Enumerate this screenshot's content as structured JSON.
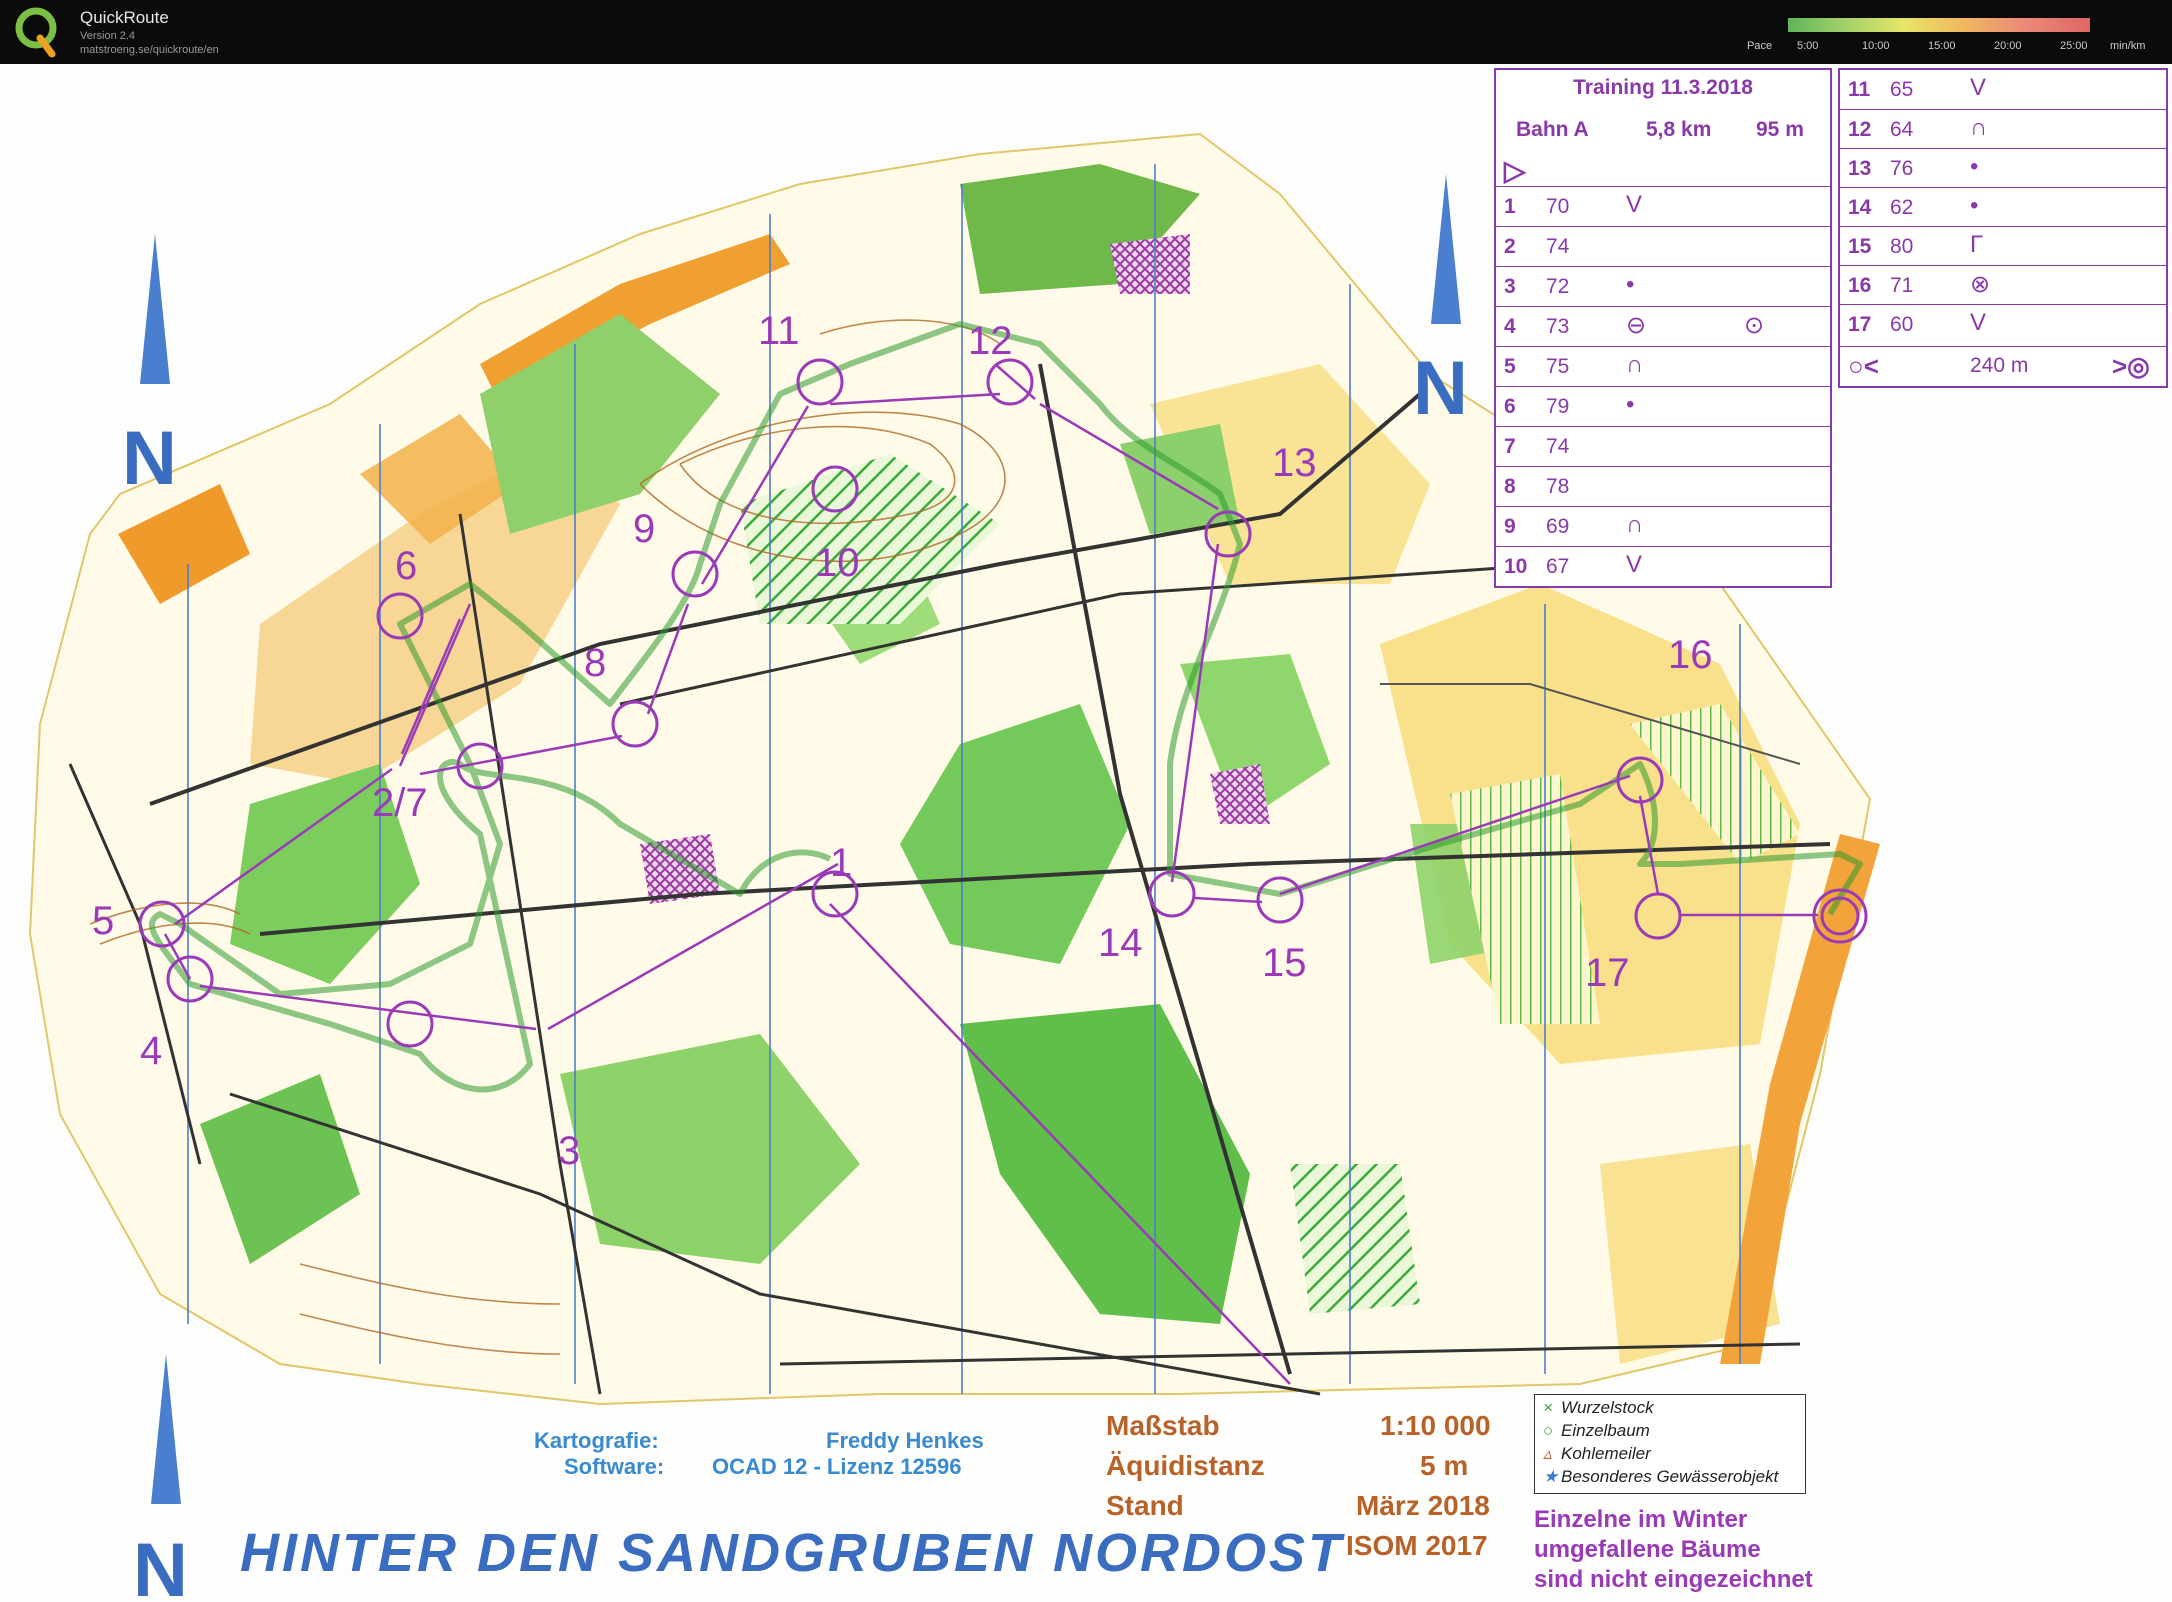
{
  "app": {
    "name": "QuickRoute",
    "version": "Version 2.4",
    "url": "matstroeng.se/quickroute/en"
  },
  "pace_scale": {
    "label": "Pace",
    "ticks": [
      "5:00",
      "10:00",
      "15:00",
      "20:00",
      "25:00"
    ],
    "unit": "min/km",
    "gradient_colors": [
      "#5fb55a",
      "#9fd06a",
      "#e7e56a",
      "#f0b860",
      "#eb8a78",
      "#e06666"
    ]
  },
  "map": {
    "title": "HINTER DEN SANDGRUBEN NORDOST",
    "credits": {
      "cartography_label": "Kartografie:",
      "cartography_value": "Freddy Henkes",
      "software_label": "Software:",
      "software_value": "OCAD 12 - Lizenz 12596"
    },
    "specs": {
      "scale_label": "Maßstab",
      "scale_value": "1:10 000",
      "contour_label": "Äquidistanz",
      "contour_value": "5 m",
      "status_label": "Stand",
      "status_value": "März 2018",
      "standard_value": "ISOM 2017"
    },
    "symbol_legend": [
      {
        "symbol": "×",
        "label": "Wurzelstock",
        "color": "#3aa040"
      },
      {
        "symbol": "○",
        "label": "Einzelbaum",
        "color": "#3aa040"
      },
      {
        "symbol": "▵",
        "label": "Kohlemeiler",
        "color": "#c0502a"
      },
      {
        "symbol": "★",
        "label": "Besonderes Gewässerobjekt",
        "color": "#3a7ad0"
      }
    ],
    "note": [
      "Einzelne im Winter",
      "umgefallene Bäume",
      "sind nicht eingezeichnet"
    ],
    "north_arrow": "N",
    "controls": [
      {
        "n": "1",
        "label": "1"
      },
      {
        "n": "2",
        "label": "2/7"
      },
      {
        "n": "3",
        "label": "3"
      },
      {
        "n": "4",
        "label": "4"
      },
      {
        "n": "5",
        "label": "5"
      },
      {
        "n": "6",
        "label": "6"
      },
      {
        "n": "8",
        "label": "8"
      },
      {
        "n": "9",
        "label": "9"
      },
      {
        "n": "10",
        "label": "10"
      },
      {
        "n": "11",
        "label": "11"
      },
      {
        "n": "12",
        "label": "12"
      },
      {
        "n": "13",
        "label": "13"
      },
      {
        "n": "14",
        "label": "14"
      },
      {
        "n": "15",
        "label": "15"
      },
      {
        "n": "16",
        "label": "16"
      },
      {
        "n": "17",
        "label": "17"
      }
    ]
  },
  "control_descriptions": {
    "title": "Training 11.3.2018",
    "course": "Bahn A",
    "length": "5,8 km",
    "climb": "95 m",
    "start_symbol": "▷",
    "rows_left": [
      {
        "num": "1",
        "code": "70",
        "feature": "V",
        "extra": ""
      },
      {
        "num": "2",
        "code": "74",
        "feature": "",
        "extra": ""
      },
      {
        "num": "3",
        "code": "72",
        "feature": "•",
        "extra": ""
      },
      {
        "num": "4",
        "code": "73",
        "feature": "⊖",
        "extra": "⊙"
      },
      {
        "num": "5",
        "code": "75",
        "feature": "∩",
        "extra": ""
      },
      {
        "num": "6",
        "code": "79",
        "feature": "•",
        "extra": ""
      },
      {
        "num": "7",
        "code": "74",
        "feature": "",
        "extra": ""
      },
      {
        "num": "8",
        "code": "78",
        "feature": "",
        "extra": ""
      },
      {
        "num": "9",
        "code": "69",
        "feature": "∩",
        "extra": ""
      },
      {
        "num": "10",
        "code": "67",
        "feature": "V",
        "extra": ""
      }
    ],
    "rows_right": [
      {
        "num": "11",
        "code": "65",
        "feature": "V"
      },
      {
        "num": "12",
        "code": "64",
        "feature": "∩"
      },
      {
        "num": "13",
        "code": "76",
        "feature": "•"
      },
      {
        "num": "14",
        "code": "62",
        "feature": "•"
      },
      {
        "num": "15",
        "code": "80",
        "feature": "Γ"
      },
      {
        "num": "16",
        "code": "71",
        "feature": "⊗"
      },
      {
        "num": "17",
        "code": "60",
        "feature": "V"
      }
    ],
    "finish_distance": "240 m"
  }
}
